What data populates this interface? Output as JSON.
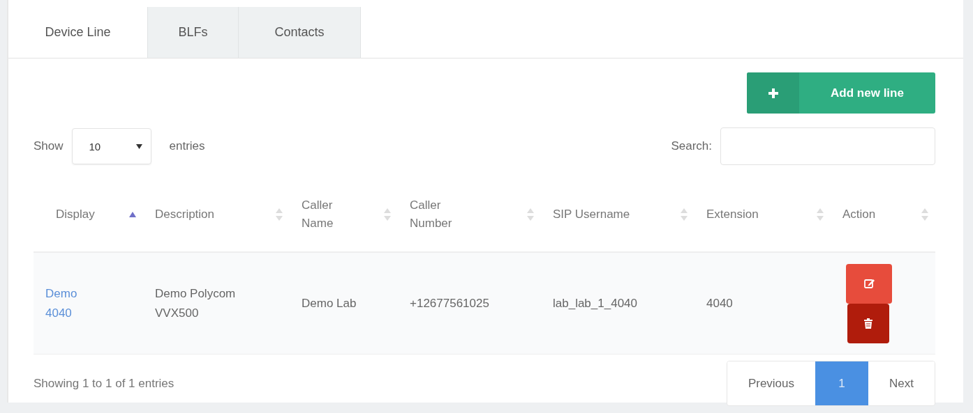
{
  "tabs": [
    {
      "label": "Device Line",
      "selected": true
    },
    {
      "label": "BLFs",
      "selected": false
    },
    {
      "label": "Contacts",
      "selected": false
    }
  ],
  "add_button": {
    "label": "Add new line"
  },
  "length_menu": {
    "before": "Show",
    "value": "10",
    "after": "entries"
  },
  "search": {
    "label": "Search:"
  },
  "table": {
    "columns": [
      {
        "label": "Display",
        "sorted": true
      },
      {
        "label": "Description",
        "sorted": false
      },
      {
        "label": "Caller Name",
        "sorted": false
      },
      {
        "label": "Caller Number",
        "sorted": false
      },
      {
        "label": "SIP Username",
        "sorted": false
      },
      {
        "label": "Extension",
        "sorted": false
      },
      {
        "label": "Action",
        "sorted": false
      }
    ],
    "rows": [
      {
        "display": "Demo 4040",
        "description": "Demo Polycom VVX500",
        "caller_name": "Demo Lab",
        "caller_number": "+12677561025",
        "sip_username": "lab_lab_1_4040",
        "extension": "4040",
        "actions": [
          {
            "kind": "edit"
          },
          {
            "kind": "delete"
          }
        ]
      }
    ]
  },
  "info": "Showing 1 to 1 of 1 entries",
  "pagination": [
    {
      "label": "Previous",
      "selected": false
    },
    {
      "label": "1",
      "selected": true
    },
    {
      "label": "Next",
      "selected": false
    }
  ]
}
